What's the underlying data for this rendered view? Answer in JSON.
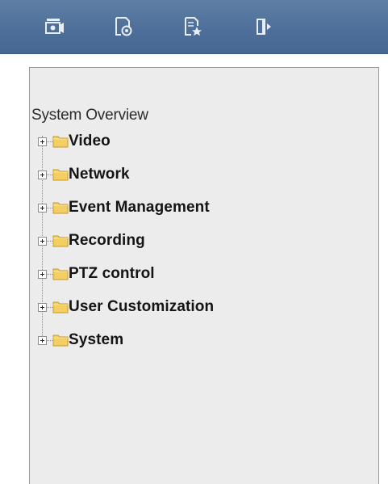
{
  "toolbar": {
    "buttons": [
      {
        "name": "camera-view-button",
        "icon": "video-camera-icon"
      },
      {
        "name": "playback-button",
        "icon": "document-camera-icon"
      },
      {
        "name": "client-settings-button",
        "icon": "document-star-icon"
      },
      {
        "name": "logout-button",
        "icon": "door-exit-icon"
      }
    ]
  },
  "tree": {
    "root_label": "System Overview",
    "items": [
      {
        "label": "Video"
      },
      {
        "label": "Network"
      },
      {
        "label": "Event Management"
      },
      {
        "label": "Recording"
      },
      {
        "label": "PTZ control"
      },
      {
        "label": "User Customization"
      },
      {
        "label": "System"
      }
    ]
  },
  "colors": {
    "toolbar": "#4e6f99",
    "panel": "#ececec",
    "folder": "#f3cf63"
  }
}
